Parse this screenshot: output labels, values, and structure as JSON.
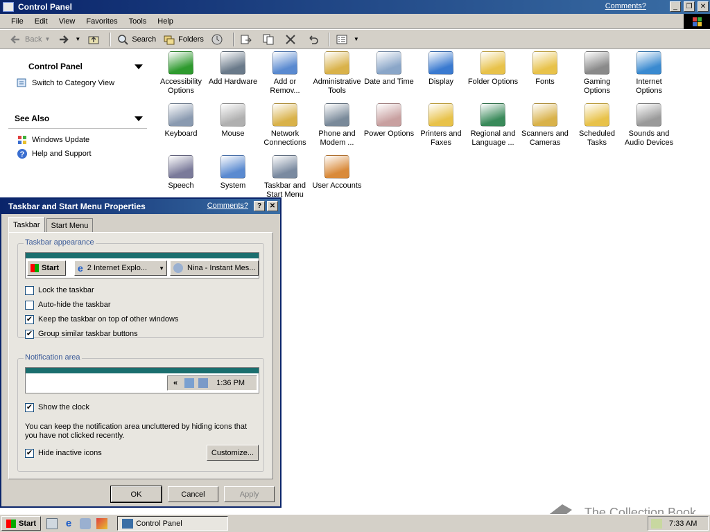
{
  "window": {
    "title": "Control Panel",
    "comments_link": "Comments?",
    "buttons": [
      "_",
      "❐",
      "✕"
    ]
  },
  "menubar": [
    "File",
    "Edit",
    "View",
    "Favorites",
    "Tools",
    "Help"
  ],
  "toolbar": {
    "back": "Back",
    "search": "Search",
    "folders": "Folders"
  },
  "sidebar": {
    "panel_title": "Control Panel",
    "switch_view": "Switch to Category View",
    "see_also_title": "See Also",
    "see_also": [
      "Windows Update",
      "Help and Support"
    ]
  },
  "items": [
    {
      "label": "Accessibility Options",
      "lines": [
        "Accessibility",
        "Options"
      ],
      "icon": "accessibility-icon",
      "color": "#2e9a2e"
    },
    {
      "label": "Add Hardware",
      "lines": [
        "Add Hardware"
      ],
      "icon": "add-hardware-icon",
      "color": "#6a7a8a"
    },
    {
      "label": "Add or Remov...",
      "lines": [
        "Add or",
        "Remov..."
      ],
      "icon": "add-remove-programs-icon",
      "color": "#5a8ad0"
    },
    {
      "label": "Administrative Tools",
      "lines": [
        "Administrative",
        "Tools"
      ],
      "icon": "administrative-tools-icon",
      "color": "#d9b24a"
    },
    {
      "label": "Date and Time",
      "lines": [
        "Date and Time"
      ],
      "icon": "date-time-icon",
      "color": "#8aa6c8"
    },
    {
      "label": "Display",
      "lines": [
        "Display"
      ],
      "icon": "display-icon",
      "color": "#3a7ad0"
    },
    {
      "label": "Folder Options",
      "lines": [
        "Folder Options"
      ],
      "icon": "folder-options-icon",
      "color": "#e8c24a"
    },
    {
      "label": "Fonts",
      "lines": [
        "Fonts"
      ],
      "icon": "fonts-icon",
      "color": "#e8c24a"
    },
    {
      "label": "Gaming Options",
      "lines": [
        "Gaming",
        "Options"
      ],
      "icon": "gaming-options-icon",
      "color": "#8a8a8a"
    },
    {
      "label": "Internet Options",
      "lines": [
        "Internet",
        "Options"
      ],
      "icon": "internet-options-icon",
      "color": "#3a8ad0"
    },
    {
      "label": "Keyboard",
      "lines": [
        "Keyboard"
      ],
      "icon": "keyboard-icon",
      "color": "#8a9ab0"
    },
    {
      "label": "Mouse",
      "lines": [
        "Mouse"
      ],
      "icon": "mouse-icon",
      "color": "#b0b0b0"
    },
    {
      "label": "Network Connections",
      "lines": [
        "Network",
        "Connections"
      ],
      "icon": "network-connections-icon",
      "color": "#d9b24a"
    },
    {
      "label": "Phone and Modem ...",
      "lines": [
        "Phone and",
        "Modem ..."
      ],
      "icon": "phone-modem-icon",
      "color": "#7a8a9a"
    },
    {
      "label": "Power Options",
      "lines": [
        "Power Options"
      ],
      "icon": "power-options-icon",
      "color": "#c8a0a0"
    },
    {
      "label": "Printers and Faxes",
      "lines": [
        "Printers and",
        "Faxes"
      ],
      "icon": "printers-faxes-icon",
      "color": "#e8c24a"
    },
    {
      "label": "Regional and Language ...",
      "lines": [
        "Regional and",
        "Language ..."
      ],
      "icon": "regional-language-icon",
      "color": "#3a8a5a"
    },
    {
      "label": "Scanners and Cameras",
      "lines": [
        "Scanners and",
        "Cameras"
      ],
      "icon": "scanners-cameras-icon",
      "color": "#d9b24a"
    },
    {
      "label": "Scheduled Tasks",
      "lines": [
        "Scheduled",
        "Tasks"
      ],
      "icon": "scheduled-tasks-icon",
      "color": "#e8c24a"
    },
    {
      "label": "Sounds and Audio Devices",
      "lines": [
        "Sounds and",
        "Audio Devices"
      ],
      "icon": "sounds-audio-icon",
      "color": "#9a9a9a"
    },
    {
      "label": "Speech",
      "lines": [
        "Speech"
      ],
      "icon": "speech-icon",
      "color": "#7a7a9a"
    },
    {
      "label": "System",
      "lines": [
        "System"
      ],
      "icon": "system-icon",
      "color": "#5a8ad0"
    },
    {
      "label": "Taskbar and Start Menu",
      "lines": [
        "Taskbar and",
        "Start Menu"
      ],
      "icon": "taskbar-start-menu-icon",
      "color": "#7a8aa0"
    },
    {
      "label": "User Accounts",
      "lines": [
        "User Accounts"
      ],
      "icon": "user-accounts-icon",
      "color": "#d98a3a"
    }
  ],
  "dialog": {
    "title": "Taskbar and Start Menu Properties",
    "comments_link": "Comments?",
    "help": "?",
    "close": "✕",
    "tabs": [
      "Taskbar",
      "Start Menu"
    ],
    "appearance_group": "Taskbar appearance",
    "preview": {
      "start": "Start",
      "task1": "2 Internet Explo...",
      "task2": "Nina - Instant Mes..."
    },
    "options": [
      {
        "label": "Lock the taskbar",
        "checked": false
      },
      {
        "label": "Auto-hide the taskbar",
        "checked": false
      },
      {
        "label": "Keep the taskbar on top of other windows",
        "checked": true
      },
      {
        "label": "Group similar taskbar buttons",
        "checked": true
      }
    ],
    "notification_group": "Notification area",
    "tray_preview": {
      "chevron": "«",
      "time": "1:36 PM"
    },
    "show_clock": {
      "label": "Show the clock",
      "checked": true
    },
    "info_text": "You can keep the notification area uncluttered by hiding icons that you have not clicked recently.",
    "hide_inactive": {
      "label": "Hide inactive icons",
      "checked": true
    },
    "customize": "Customize...",
    "ok": "OK",
    "cancel": "Cancel",
    "apply": "Apply"
  },
  "taskbar": {
    "start": "Start",
    "task": "Control Panel",
    "clock": "7:33 AM"
  },
  "watermark": "The Collection Book"
}
